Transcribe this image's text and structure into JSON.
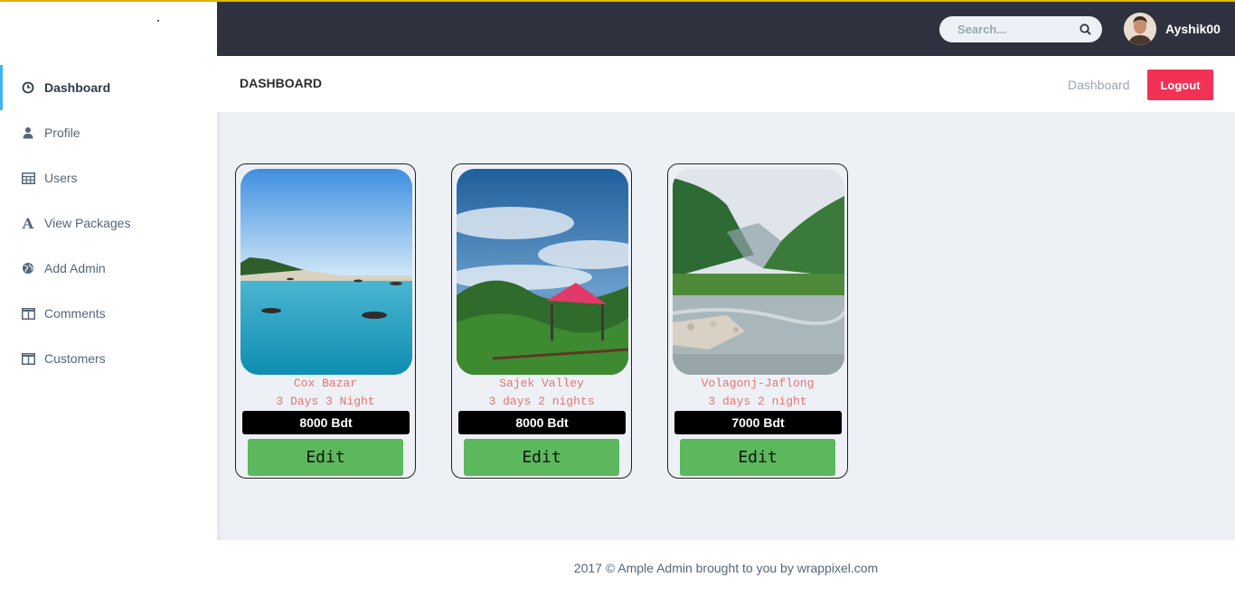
{
  "sidebar": {
    "items": [
      {
        "label": "Dashboard",
        "icon": "clock-icon"
      },
      {
        "label": "Profile",
        "icon": "user-icon"
      },
      {
        "label": "Users",
        "icon": "table-icon"
      },
      {
        "label": "View Packages",
        "icon": "font-icon"
      },
      {
        "label": "Add Admin",
        "icon": "globe-icon"
      },
      {
        "label": "Comments",
        "icon": "columns-icon"
      },
      {
        "label": "Customers",
        "icon": "columns-icon"
      }
    ],
    "active_index": 0
  },
  "header": {
    "search_placeholder": "Search...",
    "username": "Ayshik00"
  },
  "page": {
    "title": "DASHBOARD",
    "breadcrumb": "Dashboard",
    "logout_label": "Logout"
  },
  "packages": [
    {
      "name": "Cox Bazar",
      "duration": "3 Days 3 Night",
      "price": "8000 Bdt",
      "edit_label": "Edit"
    },
    {
      "name": "Sajek Valley",
      "duration": "3 days 2 nights",
      "price": "8000 Bdt",
      "edit_label": "Edit"
    },
    {
      "name": "Volagonj-Jaflong",
      "duration": "3 days 2 night",
      "price": "7000 Bdt",
      "edit_label": "Edit"
    }
  ],
  "footer": {
    "text": "2017 © Ample Admin brought to you by wrappixel.com"
  },
  "colors": {
    "topbar": "#2f323e",
    "accent_active": "#41b3f9",
    "logout": "#f33155",
    "edit_button": "#5cb85c",
    "package_text": "#e57373"
  }
}
